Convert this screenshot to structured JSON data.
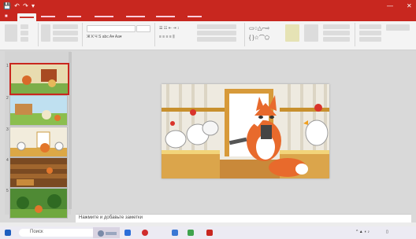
{
  "notes": {
    "placeholder": "Нажмите и добавьте заметки"
  },
  "taskbar": {
    "search_placeholder": "Поиск"
  },
  "colors": {
    "accent": "#c8271f"
  }
}
